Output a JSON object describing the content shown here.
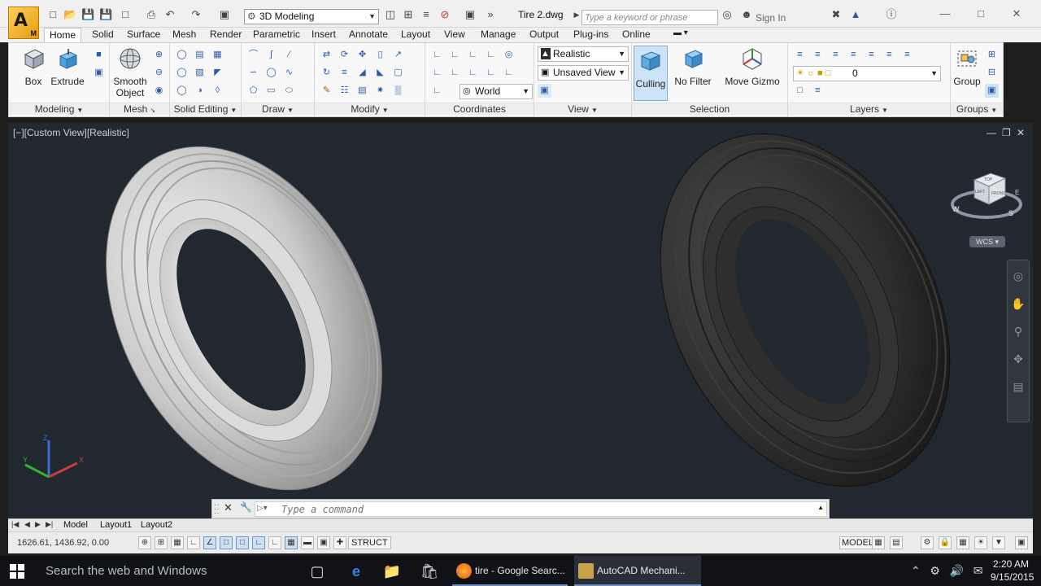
{
  "titlebar": {
    "workspace": "3D Modeling",
    "document_title": "Tire 2.dwg",
    "search_placeholder": "Type a keyword or phrase",
    "sign_in": "Sign In"
  },
  "ribbon_tabs": [
    "Home",
    "Solid",
    "Surface",
    "Mesh",
    "Render",
    "Parametric",
    "Insert",
    "Annotate",
    "Layout",
    "View",
    "Manage",
    "Output",
    "Plug-ins",
    "Online"
  ],
  "ribbon_active_tab": "Home",
  "panels": {
    "modeling": {
      "label": "Modeling",
      "box": "Box",
      "extrude": "Extrude"
    },
    "mesh": {
      "label": "Mesh",
      "smooth_object_line1": "Smooth",
      "smooth_object_line2": "Object"
    },
    "solid_editing": {
      "label": "Solid Editing"
    },
    "draw": {
      "label": "Draw"
    },
    "modify": {
      "label": "Modify"
    },
    "coordinates": {
      "label": "Coordinates",
      "ucs_combo": "World"
    },
    "view": {
      "label": "View",
      "visual_style": "Realistic",
      "named_view": "Unsaved View"
    },
    "selection": {
      "label": "Selection",
      "culling": "Culling",
      "no_filter": "No Filter",
      "move_gizmo": "Move Gizmo"
    },
    "layers": {
      "label": "Layers",
      "layer_combo": "0"
    },
    "groups": {
      "label": "Groups",
      "group": "Group"
    }
  },
  "viewport": {
    "label": "[−][Custom View][Realistic]",
    "viewcube": {
      "top": "TOP",
      "left": "LEFT",
      "front": "FRONT",
      "compass_w": "W",
      "compass_s": "S",
      "compass_e": "E"
    },
    "wcs": "WCS",
    "ucs_x": "X",
    "ucs_y": "Y",
    "ucs_z": "Z"
  },
  "command_line": {
    "placeholder": "Type a command"
  },
  "layout_tabs": [
    "Model",
    "Layout1",
    "Layout2"
  ],
  "statusbar": {
    "coordinates": "1626.61, 1436.92, 0.00",
    "struct": "STRUCT",
    "model": "MODEL"
  },
  "taskbar": {
    "search": "Search the web and Windows",
    "tasks": [
      {
        "label": "tire - Google Searc..."
      },
      {
        "label": "AutoCAD Mechani..."
      }
    ],
    "time": "2:20 AM",
    "date": "9/15/2015"
  },
  "colors": {
    "viewport_bg": "#212830",
    "ribbon_bg": "#f8f8f8",
    "accent": "#3c7fd1",
    "taskbar_bg": "#101217"
  }
}
